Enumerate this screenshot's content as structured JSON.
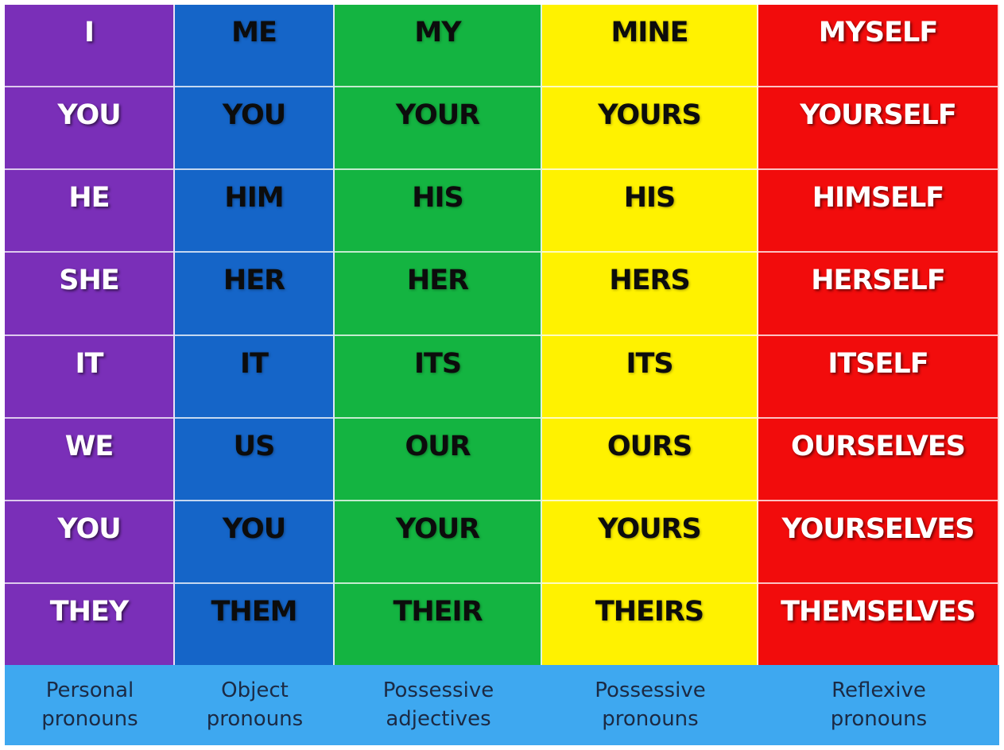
{
  "colors": {
    "personal": "#7a2fb8",
    "object": "#1565c8",
    "possessive_adjectives": "#14b441",
    "possessive_pronouns": "#fff200",
    "reflexive": "#f20c0c",
    "label_bar": "#3ea8f0"
  },
  "columns": [
    {
      "key": "personal",
      "text_style": "light",
      "words": [
        "I",
        "YOU",
        "HE",
        "SHE",
        "IT",
        "WE",
        "YOU",
        "THEY"
      ],
      "label": [
        "Personal",
        "pronouns"
      ]
    },
    {
      "key": "object",
      "text_style": "dark",
      "words": [
        "ME",
        "YOU",
        "HIM",
        "HER",
        "IT",
        "US",
        "YOU",
        "THEM"
      ],
      "label": [
        "Object",
        "pronouns"
      ]
    },
    {
      "key": "possessive_adjectives",
      "text_style": "dark",
      "words": [
        "MY",
        "YOUR",
        "HIS",
        "HER",
        "ITS",
        "OUR",
        "YOUR",
        "THEIR"
      ],
      "label": [
        "Possessive",
        "adjectives"
      ]
    },
    {
      "key": "possessive_pronouns",
      "text_style": "dark",
      "words": [
        "MINE",
        "YOURS",
        "HIS",
        "HERS",
        "ITS",
        "OURS",
        "YOURS",
        "THEIRS"
      ],
      "label": [
        "Possessive",
        "pronouns"
      ]
    },
    {
      "key": "reflexive",
      "text_style": "light",
      "words": [
        "MYSELF",
        "YOURSELF",
        "HIMSELF",
        "HERSELF",
        "ITSELF",
        "OURSELVES",
        "YOURSELVES",
        "THEMSELVES"
      ],
      "label": [
        "Reflexive",
        "pronouns"
      ]
    }
  ]
}
